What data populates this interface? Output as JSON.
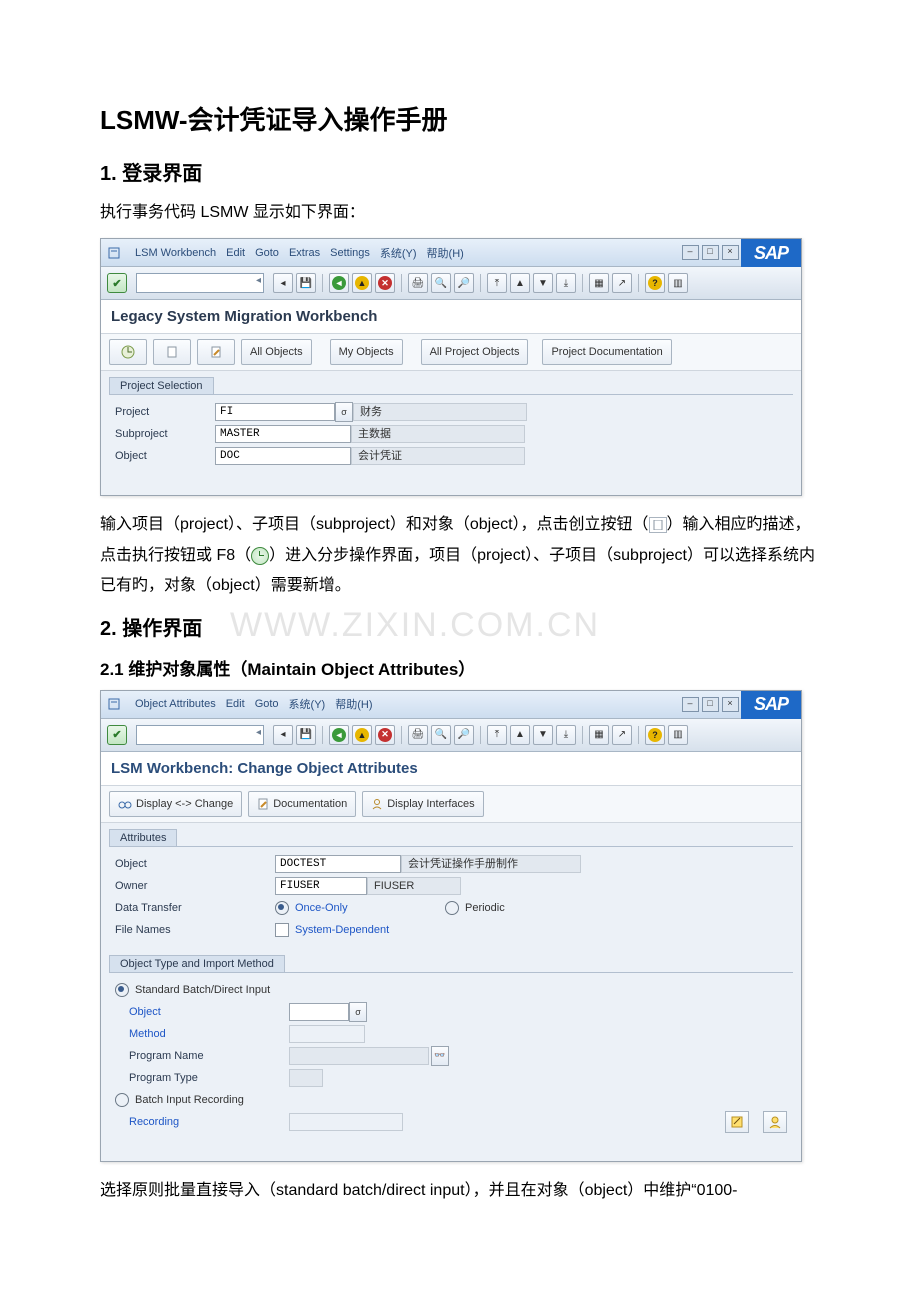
{
  "doc": {
    "title": "LSMW-会计凭证导入操作手册",
    "h2_1": "1.  登录界面",
    "p1": "执行事务代码 LSMW 显示如下界面：",
    "p2_a": "输入项目（project）、子项目（subproject）和对象（object），点击创立按钮（",
    "p2_b": "）输入相应旳描述，点击执行按钮或 F8（",
    "p2_c": "）进入分步操作界面，项目（project）、子项目（subproject）可以选择系统内已有旳，对象（object）需要新增。",
    "h2_2": "2.  操作界面",
    "h3_21": "2.1 维护对象属性（Maintain Object Attributes）",
    "p3": "选择原则批量直接导入（standard batch/direct input），并且在对象（object）中维护“0100-",
    "watermark": "WWW.ZIXIN.COM.CN"
  },
  "screen1": {
    "menu": [
      "LSM Workbench",
      "Edit",
      "Goto",
      "Extras",
      "Settings",
      "系统(Y)",
      "帮助(H)"
    ],
    "title": "Legacy System Migration Workbench",
    "app_buttons": {
      "all_objects": "All Objects",
      "my_objects": "My Objects",
      "all_project_objects": "All Project Objects",
      "project_documentation": "Project Documentation"
    },
    "group": "Project Selection",
    "rows": {
      "project_lbl": "Project",
      "project_val": "FI",
      "project_desc": "财务",
      "subproject_lbl": "Subproject",
      "subproject_val": "MASTER",
      "subproject_desc": "主数据",
      "object_lbl": "Object",
      "object_val": "DOC",
      "object_desc": "会计凭证"
    }
  },
  "screen2": {
    "menu": [
      "Object Attributes",
      "Edit",
      "Goto",
      "系统(Y)",
      "帮助(H)"
    ],
    "title": "LSM Workbench: Change Object Attributes",
    "app_buttons": {
      "display_change": "Display <-> Change",
      "documentation": "Documentation",
      "display_interfaces": "Display Interfaces"
    },
    "group_attr": "Attributes",
    "attr": {
      "object_lbl": "Object",
      "object_val": "DOCTEST",
      "object_desc": "会计凭证操作手册制作",
      "owner_lbl": "Owner",
      "owner_val": "FIUSER",
      "owner_desc": "FIUSER",
      "dt_lbl": "Data Transfer",
      "dt_once": "Once-Only",
      "dt_periodic": "Periodic",
      "fn_lbl": "File Names",
      "fn_chk": "System-Dependent"
    },
    "group_method": "Object Type and Import Method",
    "method": {
      "std": "Standard Batch/Direct Input",
      "obj_lbl": "Object",
      "method_lbl": "Method",
      "progname_lbl": "Program Name",
      "progtype_lbl": "Program Type",
      "bir": "Batch Input Recording",
      "rec_lbl": "Recording"
    }
  }
}
